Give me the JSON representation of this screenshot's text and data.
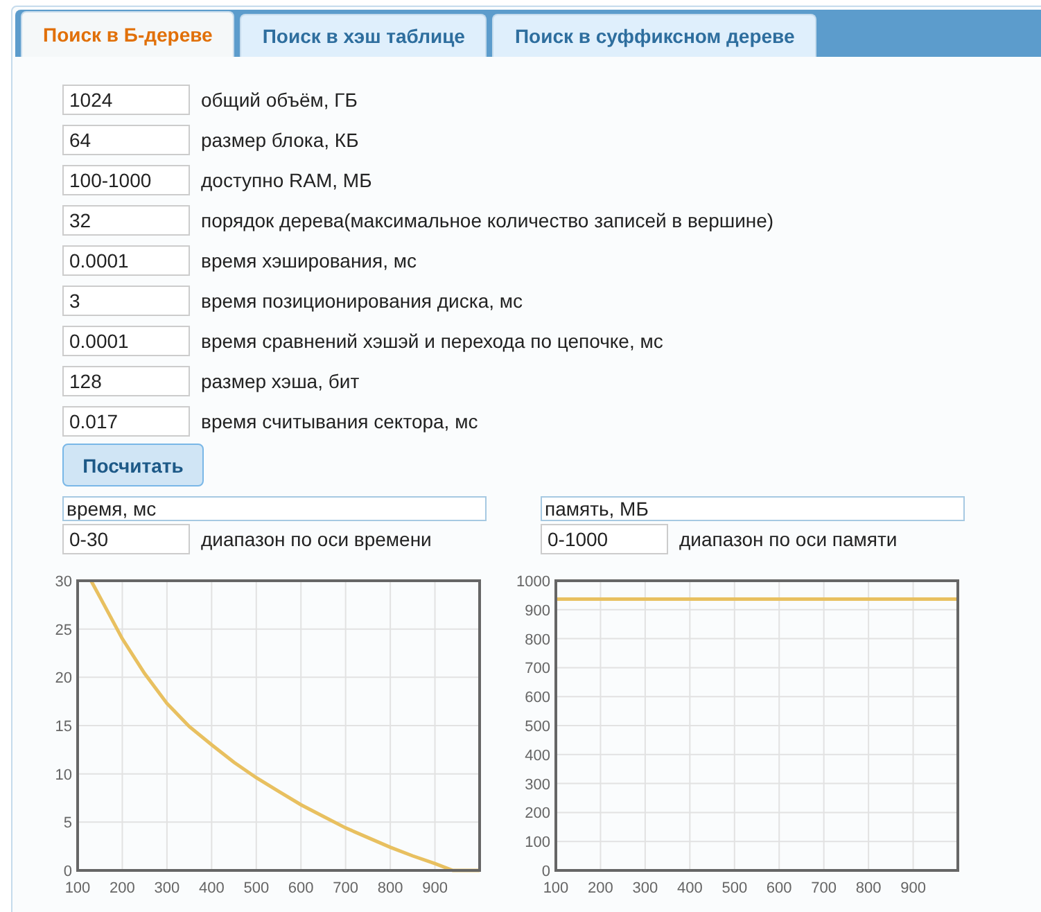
{
  "tabs": [
    {
      "label": "Поиск в Б-дереве",
      "selected": true
    },
    {
      "label": "Поиск в хэш таблице",
      "selected": false
    },
    {
      "label": "Поиск в суффиксном дереве",
      "selected": false
    }
  ],
  "params": [
    {
      "value": "1024",
      "label": "общий объём, ГБ"
    },
    {
      "value": "64",
      "label": "размер блока, КБ"
    },
    {
      "value": "100-1000",
      "label": "доступно RAM, МБ"
    },
    {
      "value": "32",
      "label": "порядок дерева(максимальное количество записей в вершине)"
    },
    {
      "value": "0.0001",
      "label": "время хэширования, мс"
    },
    {
      "value": "3",
      "label": "время позиционирования диска, мс"
    },
    {
      "value": "0.0001",
      "label": "время сравнений хэшэй и перехода по цепочке, мс"
    },
    {
      "value": "128",
      "label": "размер хэша, бит"
    },
    {
      "value": "0.017",
      "label": "время считывания сектора, мс"
    }
  ],
  "calculate_button": "Посчитать",
  "charts": [
    {
      "title_value": "время, мс",
      "range_value": "0-30",
      "range_label": "диапазон по оси времени",
      "chart_data": {
        "type": "line",
        "xlim": [
          100,
          1000
        ],
        "ylim": [
          0,
          30
        ],
        "xticks": [
          100,
          200,
          300,
          400,
          500,
          600,
          700,
          800,
          900
        ],
        "yticks": [
          0,
          5,
          10,
          15,
          20,
          25,
          30
        ],
        "x": [
          130,
          150,
          200,
          250,
          300,
          350,
          400,
          450,
          500,
          550,
          600,
          650,
          700,
          750,
          800,
          850,
          900,
          940,
          1000
        ],
        "grid": true,
        "series": [
          {
            "color": "#e8c060",
            "values": [
              30,
              28.3,
              24,
              20.4,
              17.3,
              14.9,
              13,
              11.2,
              9.6,
              8.2,
              6.8,
              5.6,
              4.4,
              3.4,
              2.4,
              1.5,
              0.7,
              0,
              0
            ]
          }
        ]
      }
    },
    {
      "title_value": "память, МБ",
      "range_value": "0-1000",
      "range_label": "диапазон по оси памяти",
      "chart_data": {
        "type": "line",
        "xlim": [
          100,
          1000
        ],
        "ylim": [
          0,
          1000
        ],
        "xticks": [
          100,
          200,
          300,
          400,
          500,
          600,
          700,
          800,
          900
        ],
        "yticks": [
          0,
          100,
          200,
          300,
          400,
          500,
          600,
          700,
          800,
          900,
          1000
        ],
        "x": [
          100,
          1000
        ],
        "grid": true,
        "series": [
          {
            "color": "#e8c060",
            "values": [
              937,
              937
            ]
          }
        ]
      }
    }
  ]
}
